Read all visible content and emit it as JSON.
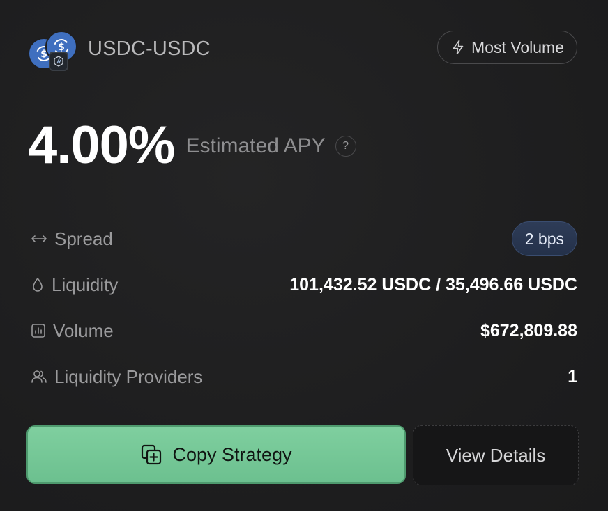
{
  "header": {
    "pair_name": "USDC-USDC",
    "badge_label": "Most Volume",
    "badge_icon": "lightning-icon"
  },
  "apy": {
    "value": "4.00%",
    "label": "Estimated APY",
    "help": "?"
  },
  "stats": {
    "spread": {
      "label": "Spread",
      "value": "2 bps",
      "icon": "arrows-horizontal-icon"
    },
    "liquidity": {
      "label": "Liquidity",
      "value": "101,432.52 USDC / 35,496.66 USDC",
      "icon": "droplet-icon"
    },
    "volume": {
      "label": "Volume",
      "value": "$672,809.88",
      "icon": "bar-chart-icon"
    },
    "providers": {
      "label": "Liquidity Providers",
      "value": "1",
      "icon": "users-icon"
    }
  },
  "actions": {
    "copy_label": "Copy Strategy",
    "details_label": "View Details"
  },
  "colors": {
    "background": "#1e1e1f",
    "coin_blue": "#3f6fbf",
    "copy_green": "#7fcf9f",
    "spread_pill": "#2e3c57"
  }
}
